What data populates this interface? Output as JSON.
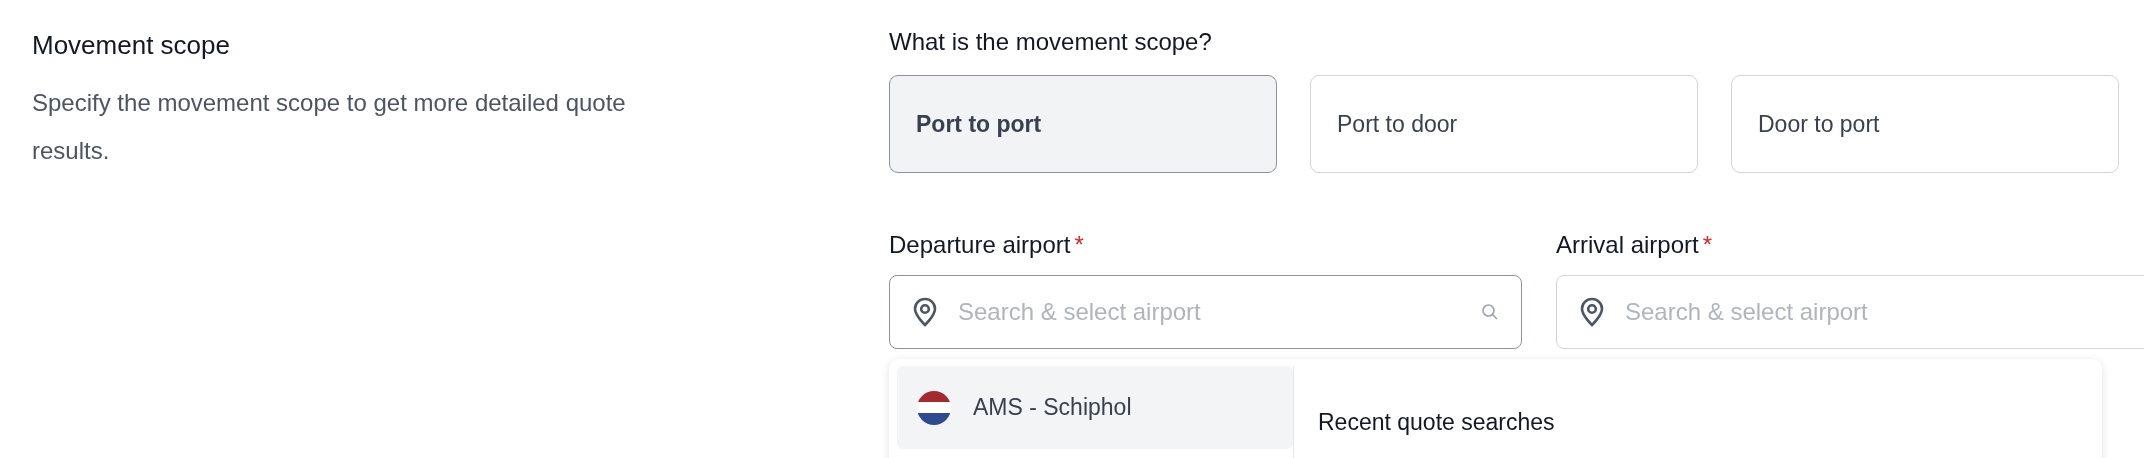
{
  "section": {
    "title": "Movement scope",
    "description": "Specify the movement scope to get more detailed quote results."
  },
  "scope": {
    "question": "What is the movement scope?",
    "options": [
      {
        "label": "Port to port",
        "selected": true
      },
      {
        "label": "Port to door",
        "selected": false
      },
      {
        "label": "Door to port",
        "selected": false
      }
    ]
  },
  "fields": [
    {
      "label": "Departure airport",
      "required": true,
      "required_mark": "*",
      "placeholder": "Search & select airport",
      "focused": true
    },
    {
      "label": "Arrival airport",
      "required": true,
      "required_mark": "*",
      "placeholder": "Search & select airport",
      "focused": false
    }
  ],
  "dropdown": {
    "airports": [
      {
        "label": "AMS - Schiphol",
        "selected": true
      }
    ],
    "recent_heading": "Recent quote searches"
  }
}
